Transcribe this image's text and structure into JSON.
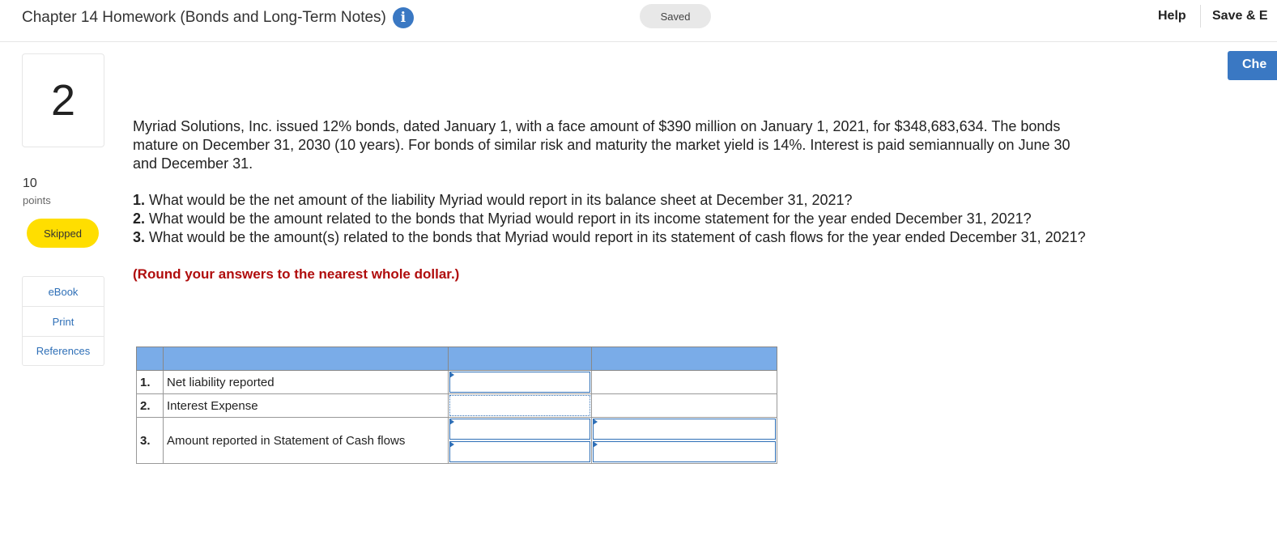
{
  "header": {
    "title": "Chapter 14 Homework (Bonds and Long-Term Notes)",
    "info_icon": "i",
    "saved": "Saved",
    "help": "Help",
    "save_exit": "Save & E",
    "check": "Che"
  },
  "sidebar": {
    "question_number": "2",
    "points_value": "10",
    "points_label": "points",
    "status": "Skipped",
    "links": [
      "eBook",
      "Print",
      "References"
    ]
  },
  "question": {
    "intro": "Myriad Solutions, Inc. issued 12% bonds, dated January 1, with a face amount of $390 million on January 1, 2021, for $348,683,634. The bonds mature on December 31, 2030 (10 years). For bonds of similar risk and maturity the market yield is 14%. Interest is paid semiannually on June 30 and December 31.",
    "items": [
      {
        "num": "1.",
        "text": "What would be the net amount of the liability Myriad would report in its balance sheet at December 31, 2021?"
      },
      {
        "num": "2.",
        "text": "What would be the amount related to the bonds that Myriad would report in its income statement for the year ended December 31, 2021?"
      },
      {
        "num": "3.",
        "text": "What would be the amount(s) related to the bonds that Myriad would report in its statement of cash flows for the year ended December 31, 2021?"
      }
    ],
    "note": "(Round your answers to the nearest whole dollar.)"
  },
  "table": {
    "rows": [
      {
        "num": "1.",
        "label": "Net liability reported",
        "value_a": "",
        "value_b": ""
      },
      {
        "num": "2.",
        "label": "Interest Expense",
        "value_a": "",
        "value_b": ""
      },
      {
        "num": "3.",
        "label": "Amount reported in Statement of Cash flows",
        "value_a_1": "",
        "value_a_2": "",
        "value_b_1": "",
        "value_b_2": ""
      }
    ]
  }
}
